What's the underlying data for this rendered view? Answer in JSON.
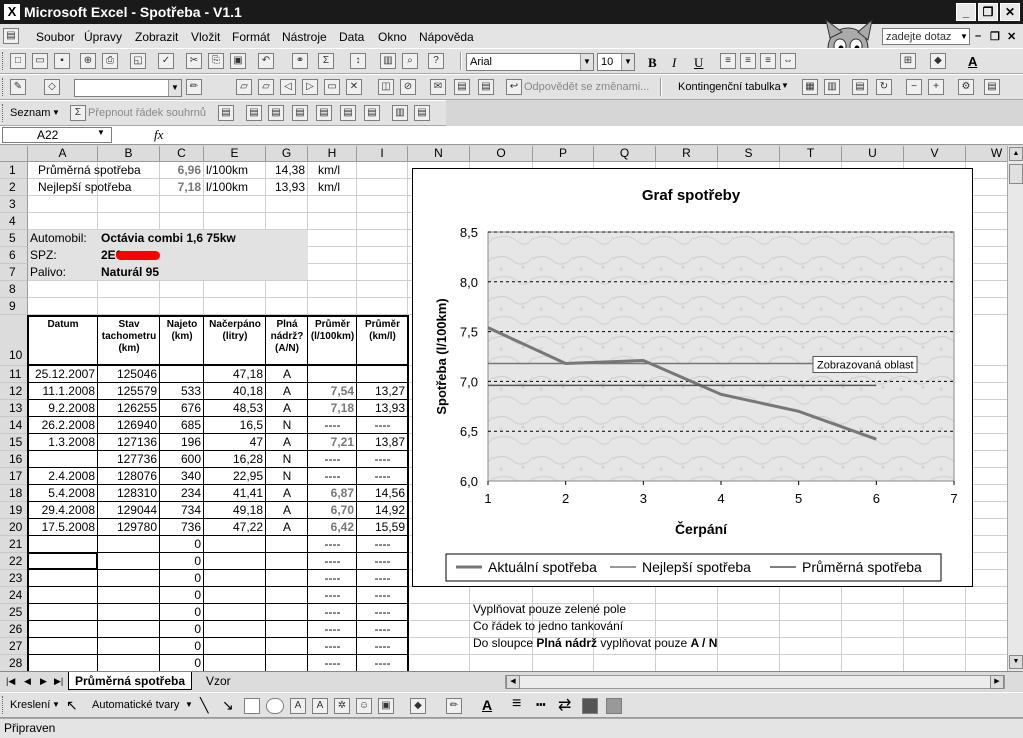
{
  "window": {
    "title": "Microsoft Excel - Spotřeba - V1.1",
    "app_icon": "excel-icon",
    "min": "_",
    "max": "❐",
    "close": "✕"
  },
  "menu": {
    "items": [
      "Soubor",
      "Úpravy",
      "Zobrazit",
      "Vložit",
      "Formát",
      "Nástroje",
      "Data",
      "Okno",
      "Nápověda"
    ],
    "ask_placeholder": "zadejte dotaz"
  },
  "toolbar": {
    "font": "Arial",
    "size": "10",
    "bold": "B",
    "italic": "I",
    "underline": "U",
    "reply_changes": "Odpovědět se změnami...",
    "pivot": "Kontingenční tabulka",
    "list": "Seznam",
    "toggle_total": "Přepnout řádek souhrnů"
  },
  "formula_bar": {
    "name_box": "A22",
    "fx": "fx",
    "formula": ""
  },
  "columns": [
    "A",
    "B",
    "C",
    "E",
    "G",
    "H",
    "I",
    "N",
    "O",
    "P",
    "Q",
    "R",
    "S",
    "T",
    "U",
    "V",
    "W"
  ],
  "rows": [
    "1",
    "2",
    "3",
    "4",
    "5",
    "6",
    "7",
    "8",
    "9",
    "10",
    "11",
    "12",
    "13",
    "14",
    "15",
    "16",
    "17",
    "18",
    "19",
    "20",
    "21",
    "22",
    "23",
    "24",
    "25",
    "26",
    "27",
    "28"
  ],
  "summary": [
    {
      "label": "Průměrná spotřeba",
      "value": "6,96",
      "unit": "l/100km",
      "value2": "14,38",
      "unit2": "km/l"
    },
    {
      "label": "Nejlepší spotřeba",
      "value": "7,18",
      "unit": "l/100km",
      "value2": "13,93",
      "unit2": "km/l"
    }
  ],
  "car": [
    {
      "label": "Automobil:",
      "value": "Octávia combi 1,6 75kw"
    },
    {
      "label": "SPZ:",
      "value": "2E0"
    },
    {
      "label": "Palivo:",
      "value": "Naturál 95"
    }
  ],
  "table": {
    "headers": [
      "Datum",
      "Stav tachometru (km)",
      "Najeto (km)",
      "Načerpáno (litry)",
      "Plná nádrž? (A/N)",
      "Průměr (l/100km)",
      "Průměr (km/l)"
    ],
    "rows": [
      [
        "25.12.2007",
        "125046",
        "",
        "47,18",
        "A",
        "",
        ""
      ],
      [
        "11.1.2008",
        "125579",
        "533",
        "40,18",
        "A",
        "7,54",
        "13,27"
      ],
      [
        "9.2.2008",
        "126255",
        "676",
        "48,53",
        "A",
        "7,18",
        "13,93"
      ],
      [
        "26.2.2008",
        "126940",
        "685",
        "16,5",
        "N",
        "----",
        "----"
      ],
      [
        "1.3.2008",
        "127136",
        "196",
        "47",
        "A",
        "7,21",
        "13,87"
      ],
      [
        "",
        "127736",
        "600",
        "16,28",
        "N",
        "----",
        "----"
      ],
      [
        "2.4.2008",
        "128076",
        "340",
        "22,95",
        "N",
        "----",
        "----"
      ],
      [
        "5.4.2008",
        "128310",
        "234",
        "41,41",
        "A",
        "6,87",
        "14,56"
      ],
      [
        "29.4.2008",
        "129044",
        "734",
        "49,18",
        "A",
        "6,70",
        "14,92"
      ],
      [
        "17.5.2008",
        "129780",
        "736",
        "47,22",
        "A",
        "6,42",
        "15,59"
      ],
      [
        "",
        "",
        "0",
        "",
        "",
        "----",
        "----"
      ],
      [
        "",
        "",
        "0",
        "",
        "",
        "----",
        "----"
      ],
      [
        "",
        "",
        "0",
        "",
        "",
        "----",
        "----"
      ],
      [
        "",
        "",
        "0",
        "",
        "",
        "----",
        "----"
      ],
      [
        "",
        "",
        "0",
        "",
        "",
        "----",
        "----"
      ],
      [
        "",
        "",
        "0",
        "",
        "",
        "----",
        "----"
      ],
      [
        "",
        "",
        "0",
        "",
        "",
        "----",
        "----"
      ],
      [
        "",
        "",
        "0",
        "",
        "",
        "----",
        "----"
      ]
    ]
  },
  "notes": [
    {
      "text": "Vyplňovat pouze zelené pole"
    },
    {
      "text": "Co řádek to jedno tankování"
    },
    {
      "prefix": "Do sloupce ",
      "bold": "Plná nádrž",
      "middle": " vyplňovat pouze ",
      "bold2": "A / N"
    }
  ],
  "chart_data": {
    "type": "line",
    "title": "Graf spotřeby",
    "xlabel": "Čerpání",
    "ylabel": "Spotřeba (l/100km)",
    "xlim": [
      1,
      7
    ],
    "ylim": [
      6.0,
      8.5
    ],
    "x_ticks": [
      "1",
      "2",
      "3",
      "4",
      "5",
      "6",
      "7"
    ],
    "y_ticks": [
      "6,0",
      "6,5",
      "7,0",
      "7,5",
      "8,0",
      "8,5"
    ],
    "series": [
      {
        "name": "Aktuální spotřeba",
        "x": [
          1,
          2,
          3,
          4,
          5,
          6
        ],
        "values": [
          7.54,
          7.18,
          7.21,
          6.87,
          6.7,
          6.42
        ],
        "color": "#777777"
      },
      {
        "name": "Nejlepší spotřeba",
        "x": [
          1,
          6
        ],
        "values": [
          7.18,
          7.18
        ],
        "color": "#777777"
      },
      {
        "name": "Průměrná spotřeba",
        "x": [
          1,
          6
        ],
        "values": [
          6.96,
          6.96
        ],
        "color": "#555555"
      }
    ],
    "tooltip": "Zobrazovaná oblast",
    "grid": true,
    "legend": "bottom"
  },
  "sheets": {
    "tabs": [
      "Průměrná spotřeba",
      "Vzor"
    ],
    "active": 0
  },
  "drawing": {
    "draw": "Kreslení",
    "autoshapes": "Automatické tvary"
  },
  "status": {
    "text": "Připraven"
  }
}
